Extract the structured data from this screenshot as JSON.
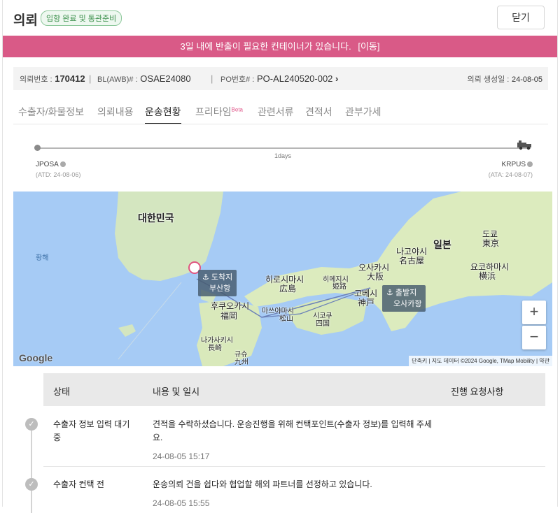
{
  "header": {
    "title": "의뢰",
    "badge": "입항 완료 및 통관준비",
    "close_label": "닫기"
  },
  "alert": {
    "message": "3일 내에 반출이 필요한 컨테이너가 있습니다.",
    "link": "[이동]"
  },
  "info": {
    "request_no_label": "의뢰번호 :",
    "request_no": "170412",
    "bl_label": "BL(AWB)# :",
    "bl_value": "OSAE24080",
    "po_label": "PO번호# :",
    "po_value": "PO-AL240520-002",
    "created_label": "의뢰 생성일 :",
    "created_value": "24-08-05"
  },
  "tabs": [
    "수출자/화물정보",
    "의뢰내용",
    "운송현황",
    "프리타임",
    "관련서류",
    "견적서",
    "관부가세"
  ],
  "tab_beta": "Beta",
  "active_tab": "운송현황",
  "tracking": {
    "progress": 1.0,
    "duration": "1days",
    "origin_code": "JPOSA",
    "origin_date": "(ATD: 24-08-06)",
    "destination_code": "KRPUS",
    "destination_date": "(ATA: 24-08-07)"
  },
  "map": {
    "labels": {
      "korea": "대한민국",
      "yellow_sea": "황해",
      "hiroshima": "히로시마시",
      "hiroshima2": "広島",
      "fukuoka": "후쿠오카시",
      "fukuoka2": "福岡",
      "nagasaki": "나가사키시",
      "nagasaki2": "長崎",
      "himeji": "히메지시",
      "himeji2": "姫路",
      "matsuyama": "마쓰야마시",
      "matsuyama2": "松山",
      "shikoku": "시코쿠",
      "shikoku2": "四国",
      "osaka": "오사카시",
      "osaka2": "大阪",
      "kobe": "고베시",
      "kobe2": "神戸",
      "nagoya": "나고야시",
      "nagoya2": "名古屋",
      "nihon": "일본",
      "tokyo": "도쿄",
      "tokyo2": "東京",
      "yokohama": "요코하마시",
      "yokohama2": "横浜",
      "kyushu": "규슈",
      "kyushu2": "九州"
    },
    "destination_marker": "도착지",
    "destination_port": "부산항",
    "origin_marker": "출발지",
    "origin_port": "오사카항",
    "zoom_in": "+",
    "zoom_out": "−",
    "google": "Google",
    "attribution": "단축키 | 지도 데이터 ©2024 Google, TMap Mobility | 약관"
  },
  "table": {
    "headers": [
      "상태",
      "내용 및 일시",
      "진행 요청사항"
    ],
    "rows": [
      {
        "status": "수출자 정보 입력 대기중",
        "content": "견적을 수락하셨습니다. 운송진행을 위해 컨택포인트(수출자 정보)를 입력해 주세요.",
        "time": "24-08-05 15:17"
      },
      {
        "status": "수출자 컨택 전",
        "content": "운송의뢰 건을 쉽다와 협업할 해외 파트너를 선정하고 있습니다.",
        "time": "24-08-05 15:55"
      }
    ]
  },
  "colors": {
    "alert_bg": "#d95a87",
    "badge_green": "#3a8f4a",
    "sea": "#a6cbf5",
    "land": "#e4efc9"
  }
}
